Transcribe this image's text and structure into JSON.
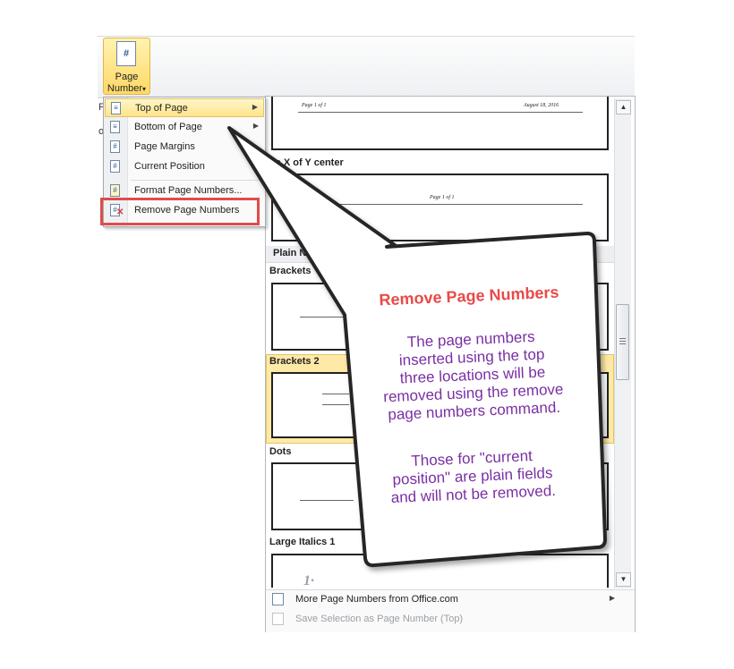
{
  "ribbon": {
    "button_label": "Page Number",
    "button_line1": "Page",
    "button_line2": "Number",
    "button_arrow": "▾",
    "icon_glyph": "#"
  },
  "menu": {
    "items": [
      {
        "label": "Top of Page",
        "icon": "page-top-icon"
      },
      {
        "label": "Bottom of Page",
        "icon": "page-bottom-icon"
      },
      {
        "label": "Page Margins",
        "icon": "page-margins-icon"
      },
      {
        "label": "Current Position",
        "icon": "current-position-icon"
      },
      {
        "label": "Format Page Numbers...",
        "icon": "format-numbers-icon"
      },
      {
        "label": "Remove Page Numbers",
        "icon": "remove-numbers-icon"
      }
    ],
    "submenu_arrow": "▶"
  },
  "gallery": {
    "preview_top_left": "Page 1 of 1",
    "preview_top_right": "August 18, 2016",
    "section_x_of_y": "ge X of Y center",
    "preview_center": "Page 1 of 1",
    "section_plain": "Plain N",
    "items": [
      "Brackets",
      "Brackets 2",
      "Dots",
      "Large Italics 1"
    ],
    "large_italic_sample": "1·"
  },
  "footer": {
    "more": "More Page Numbers from Office.com",
    "save": "Save Selection as Page Number (Top)"
  },
  "callout": {
    "title": "Remove Page Numbers",
    "body": "The page numbers\ninserted using the top\nthree locations will be\nremoved using the remove\npage numbers command.",
    "body2": "Those for \"current\nposition\" are plain fields\nand will not be removed."
  },
  "colors": {
    "highlight": "#ffe38a",
    "red_box": "#e04c4c",
    "callout_title": "#e84a4a",
    "callout_text": "#7a2fa3"
  }
}
